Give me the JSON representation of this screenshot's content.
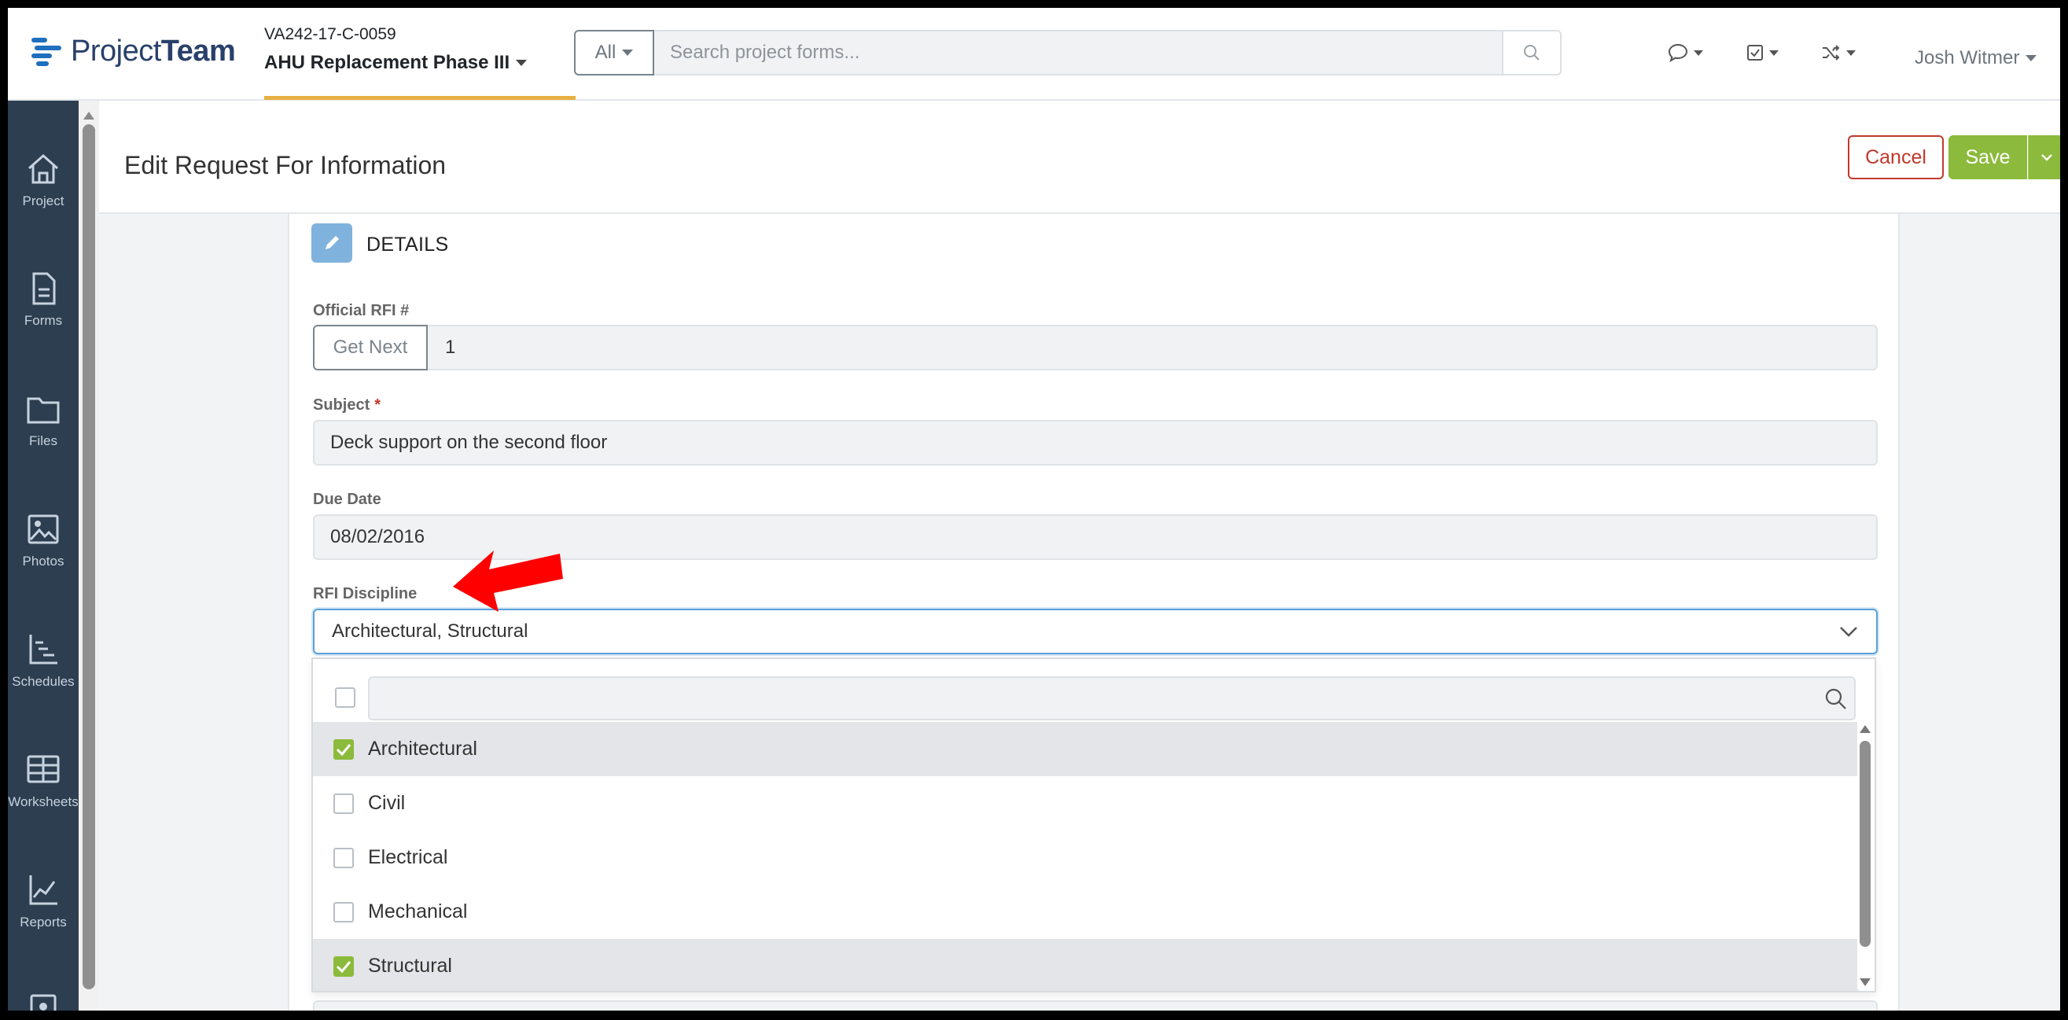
{
  "app": {
    "logo_prefix": "Project",
    "logo_suffix": "Team"
  },
  "project": {
    "code": "VA242-17-C-0059",
    "name": "AHU Replacement Phase III"
  },
  "search": {
    "scope": "All",
    "placeholder": "Search project forms..."
  },
  "user": {
    "name": "Josh Witmer"
  },
  "sidebar": {
    "items": [
      {
        "label": "Project",
        "icon": "home-icon"
      },
      {
        "label": "Forms",
        "icon": "document-icon"
      },
      {
        "label": "Files",
        "icon": "folder-icon"
      },
      {
        "label": "Photos",
        "icon": "image-icon"
      },
      {
        "label": "Schedules",
        "icon": "schedule-icon"
      },
      {
        "label": "Worksheets",
        "icon": "table-icon"
      },
      {
        "label": "Reports",
        "icon": "chart-icon"
      }
    ]
  },
  "page": {
    "title": "Edit Request For Information",
    "cancel_label": "Cancel",
    "save_label": "Save"
  },
  "details": {
    "section_title": "DETAILS",
    "official_rfi_label": "Official RFI #",
    "get_next_label": "Get Next",
    "official_rfi_value": "1",
    "subject_label": "Subject",
    "subject_required": "*",
    "subject_value": "Deck support on the second floor",
    "due_date_label": "Due Date",
    "due_date_value": "08/02/2016",
    "discipline_label": "RFI Discipline",
    "discipline_value": "Architectural, Structural"
  },
  "discipline_options": [
    {
      "label": "Architectural",
      "checked": true
    },
    {
      "label": "Civil",
      "checked": false
    },
    {
      "label": "Electrical",
      "checked": false
    },
    {
      "label": "Mechanical",
      "checked": false
    },
    {
      "label": "Structural",
      "checked": true
    }
  ],
  "colors": {
    "sidebar": "#2d3e50",
    "accent_green": "#8cba3c",
    "cancel_red": "#c0392b",
    "focus_blue": "#5aa0d8",
    "annotation_arrow": "#ff0000"
  }
}
